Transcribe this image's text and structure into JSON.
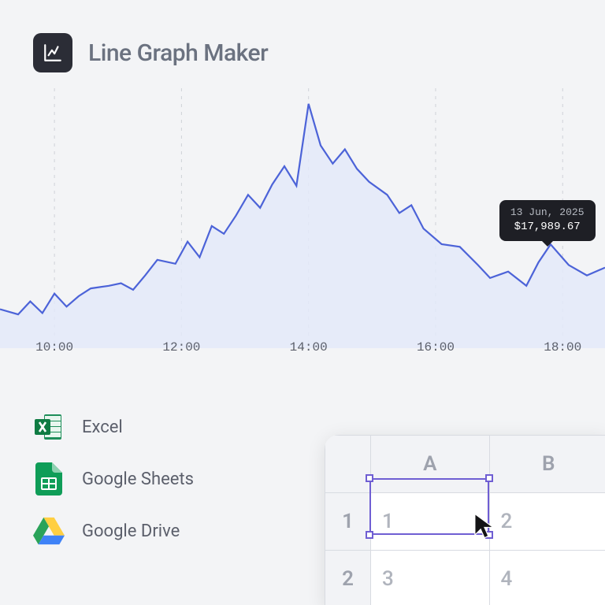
{
  "header": {
    "title": "Line Graph Maker"
  },
  "chart_data": {
    "type": "line",
    "xlabel": "",
    "ylabel": "",
    "x_ticks": [
      "10:00",
      "12:00",
      "14:00",
      "16:00",
      "18:00"
    ],
    "x_tick_positions": [
      0.09,
      0.3,
      0.51,
      0.72,
      0.93
    ],
    "ylim": [
      10000,
      30000
    ],
    "x": [
      0.0,
      0.03,
      0.05,
      0.07,
      0.09,
      0.11,
      0.13,
      0.15,
      0.18,
      0.2,
      0.22,
      0.24,
      0.26,
      0.29,
      0.31,
      0.33,
      0.35,
      0.37,
      0.39,
      0.41,
      0.43,
      0.45,
      0.47,
      0.49,
      0.51,
      0.53,
      0.55,
      0.57,
      0.59,
      0.61,
      0.64,
      0.66,
      0.68,
      0.7,
      0.73,
      0.76,
      0.79,
      0.81,
      0.84,
      0.87,
      0.89,
      0.91,
      0.94,
      0.97,
      1.0
    ],
    "values": [
      13000,
      12600,
      13600,
      12700,
      14200,
      13200,
      14000,
      14600,
      14800,
      15000,
      14500,
      15600,
      16800,
      16500,
      18200,
      17000,
      19400,
      18800,
      20200,
      21800,
      20800,
      22600,
      24000,
      22500,
      28800,
      25600,
      24200,
      25300,
      23800,
      22800,
      21800,
      20400,
      21000,
      19200,
      18000,
      17800,
      16400,
      15400,
      15900,
      14800,
      16600,
      17990,
      16400,
      15600,
      16200
    ],
    "tooltip": {
      "index": 41,
      "date": "13 Jun, 2025",
      "value_str": "$17,989.67"
    }
  },
  "integrations": [
    {
      "label": "Excel"
    },
    {
      "label": "Google Sheets"
    },
    {
      "label": "Google Drive"
    }
  ],
  "sheet": {
    "columns": [
      "A",
      "B"
    ],
    "rows": [
      {
        "num": "1",
        "cells": [
          "1",
          "2"
        ]
      },
      {
        "num": "2",
        "cells": [
          "3",
          "4"
        ]
      }
    ],
    "selected": {
      "row": 0,
      "col": 0
    }
  }
}
